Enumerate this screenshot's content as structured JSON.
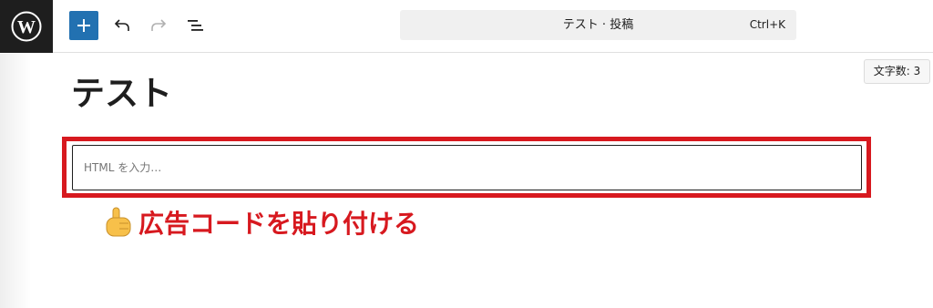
{
  "toolbar": {
    "logo_icon": "wordpress-icon",
    "inserter_icon": "plus-icon",
    "undo_icon": "undo-icon",
    "redo_icon": "redo-icon",
    "list_view_icon": "list-view-icon"
  },
  "command_bar": {
    "title": "テスト · 投稿",
    "shortcut": "Ctrl+K"
  },
  "editor": {
    "word_count": "文字数: 3",
    "post_title": "テスト",
    "html_block_placeholder": "HTML を入力…"
  },
  "annotation": {
    "icon": "pointing-hand-icon",
    "text": "広告コードを貼り付ける"
  },
  "colors": {
    "accent_blue": "#2271b1",
    "highlight_red": "#d7191f",
    "logo_bg": "#1e1e1e",
    "command_bar_bg": "#f0f0f0"
  }
}
